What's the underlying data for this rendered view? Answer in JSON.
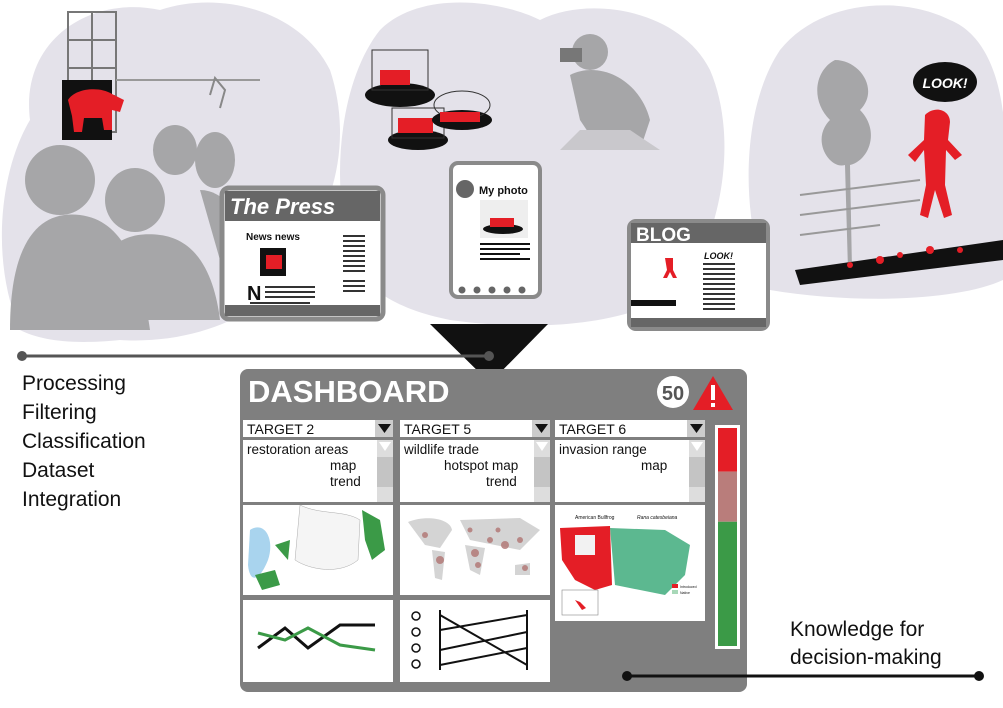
{
  "colors": {
    "cloud": "#e4e2ea",
    "silhouette": "#a6a6a8",
    "accent_red": "#e41e26",
    "panel_gray": "#7f7f7f",
    "green": "#3b9a47",
    "pink": "#b97d7b"
  },
  "scenes": {
    "press": {
      "title": "The Press",
      "headline": "News news",
      "initial": "N"
    },
    "photo": {
      "title": "My photo"
    },
    "blog": {
      "title": "BLOG",
      "callout": "LOOK!"
    },
    "speech_bubble": "LOOK!"
  },
  "process_steps": [
    "Processing",
    "Filtering",
    "Classification",
    "Dataset",
    "Integration"
  ],
  "dashboard": {
    "title": "DASHBOARD",
    "alert_count": "50",
    "alert_icon": "warning-icon",
    "indicator_levels": {
      "red": 0.2,
      "pink": 0.23,
      "green": 0.57
    },
    "targets": [
      {
        "name": "TARGET 2",
        "items": [
          "restoration areas",
          "map",
          "trend"
        ]
      },
      {
        "name": "TARGET 5",
        "items": [
          "wildlife trade",
          "hotspot map",
          "trend"
        ]
      },
      {
        "name": "TARGET 6",
        "items": [
          "invasion range",
          "map"
        ],
        "map_caption_left": "American Bullfrog",
        "map_caption_right": "Rana catesbeiana",
        "legend": [
          "Introduced",
          "Native"
        ]
      }
    ]
  },
  "output_label": [
    "Knowledge for",
    "decision-making"
  ]
}
